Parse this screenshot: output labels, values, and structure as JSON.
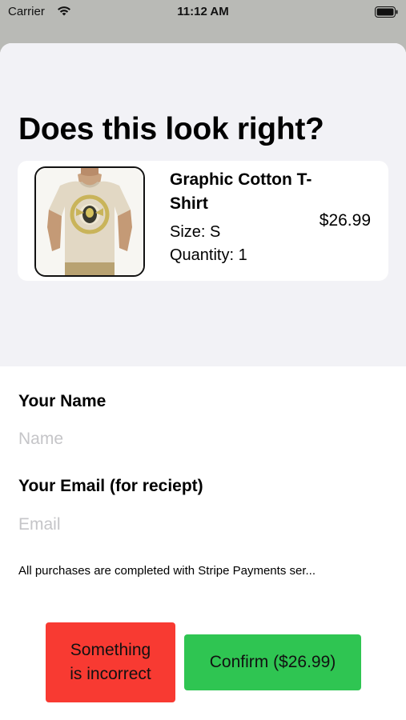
{
  "status_bar": {
    "carrier": "Carrier",
    "time": "11:12 AM"
  },
  "page": {
    "title": "Does this look right?"
  },
  "product": {
    "name": "Graphic Cotton T-Shirt",
    "price": "$26.99",
    "size": "Size: S",
    "quantity": "Quantity: 1",
    "image_icon": "tshirt-photo"
  },
  "form": {
    "name_label": "Your Name",
    "name_placeholder": "Name",
    "name_value": "",
    "email_label": "Your Email (for reciept)",
    "email_placeholder": "Email",
    "email_value": ""
  },
  "disclaimer": "All purchases are completed with Stripe Payments ser...",
  "actions": {
    "incorrect_label": "Something\nis incorrect",
    "confirm_label": "Confirm ($26.99)"
  },
  "colors": {
    "incorrect_button": "#f83a32",
    "confirm_button": "#2fc552",
    "top_background": "#f2f2f6"
  }
}
